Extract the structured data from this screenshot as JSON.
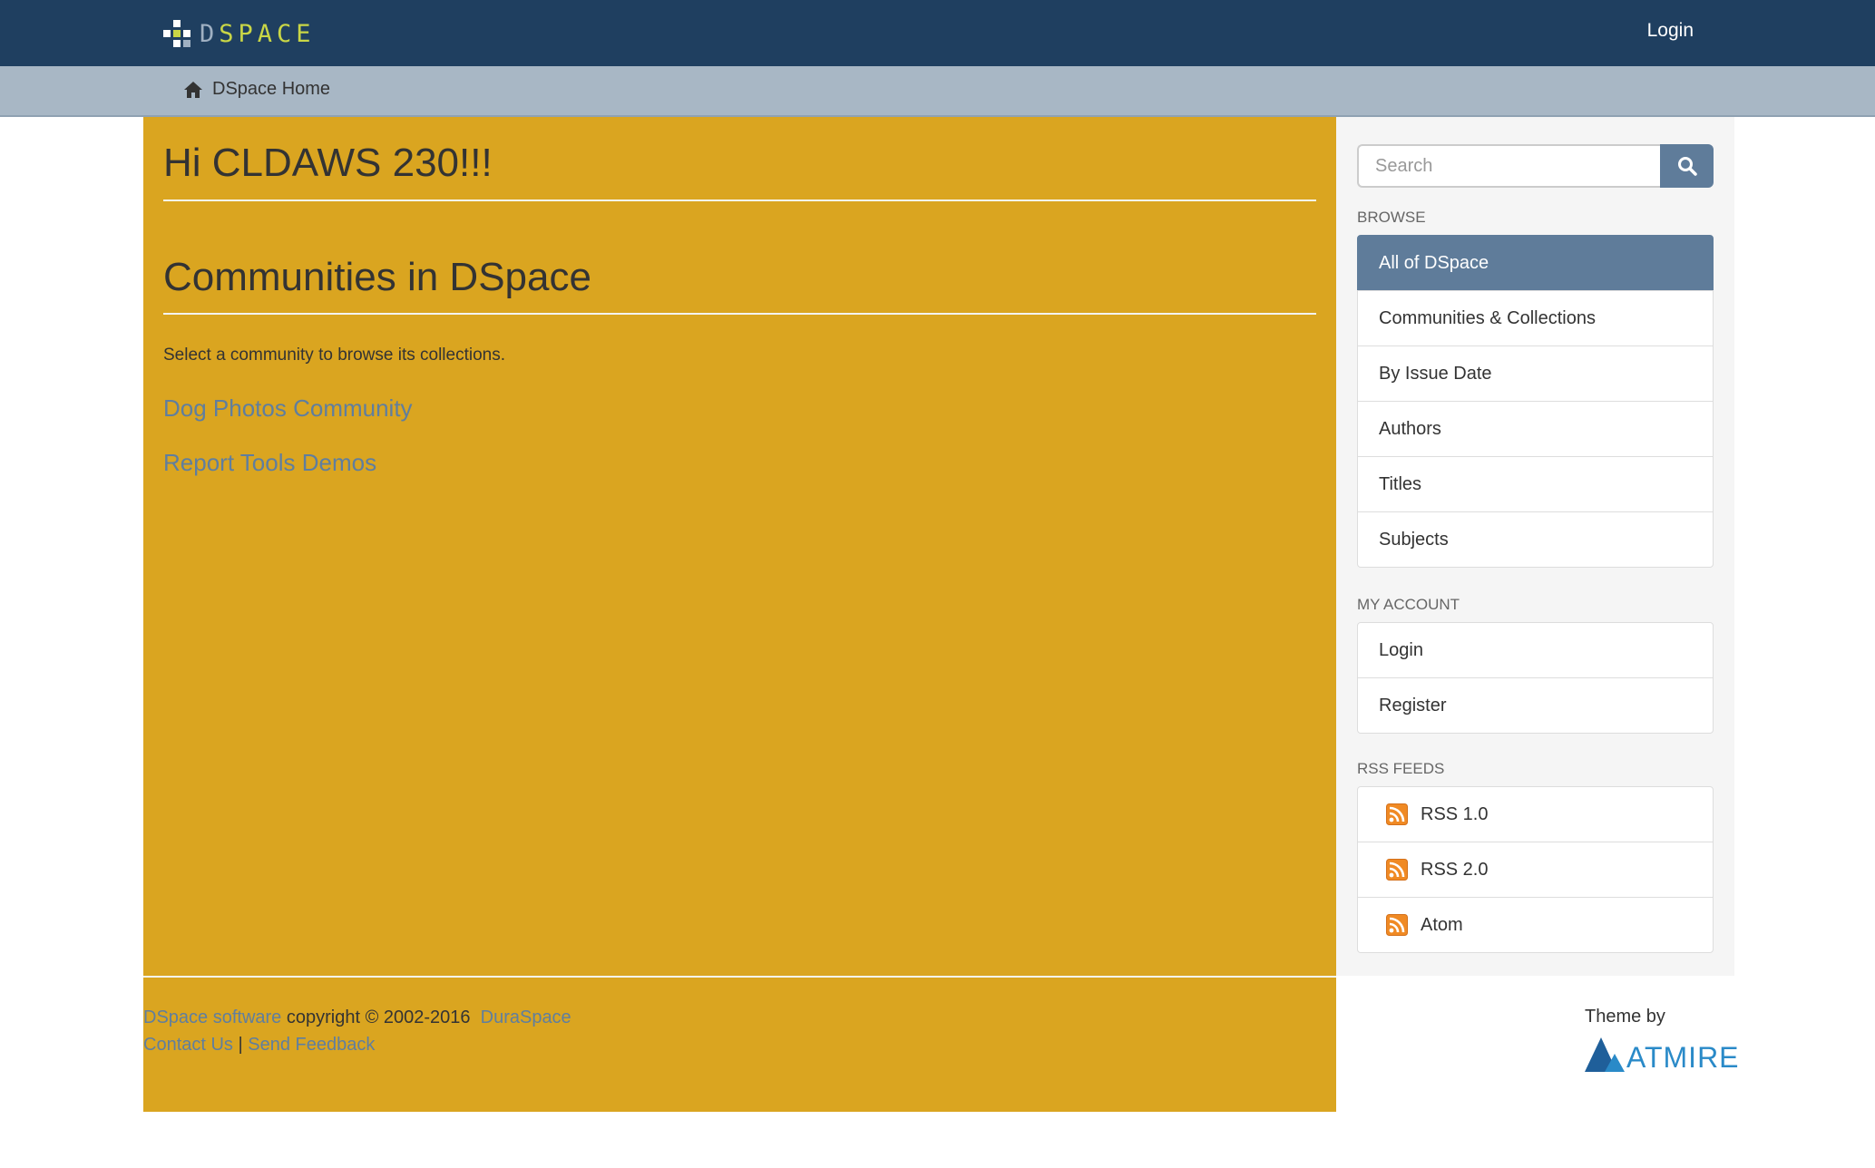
{
  "header": {
    "logo_text_d": "D",
    "logo_text_rest": "SPACE",
    "login_label": "Login",
    "colors": {
      "bar": "#1f3f60",
      "logo_accent": "#c9d646"
    }
  },
  "breadcrumb": {
    "home_icon": "home-icon",
    "label": "DSpace Home"
  },
  "main": {
    "greeting": "Hi CLDAWS 230!!!",
    "section_title": "Communities in DSpace",
    "intro": "Select a community to browse its collections.",
    "communities": [
      {
        "label": "Dog Photos Community"
      },
      {
        "label": "Report Tools Demos"
      }
    ],
    "background_color": "#daa520"
  },
  "sidebar": {
    "search": {
      "placeholder": "Search",
      "button_icon": "search-icon"
    },
    "browse": {
      "heading": "BROWSE",
      "items": [
        {
          "label": "All of DSpace",
          "active": true
        },
        {
          "label": "Communities & Collections"
        },
        {
          "label": "By Issue Date"
        },
        {
          "label": "Authors"
        },
        {
          "label": "Titles"
        },
        {
          "label": "Subjects"
        }
      ]
    },
    "account": {
      "heading": "MY ACCOUNT",
      "items": [
        {
          "label": "Login"
        },
        {
          "label": "Register"
        }
      ]
    },
    "rss": {
      "heading": "RSS FEEDS",
      "items": [
        {
          "label": "RSS 1.0",
          "icon": "rss-icon"
        },
        {
          "label": "RSS 2.0",
          "icon": "rss-icon"
        },
        {
          "label": "Atom",
          "icon": "rss-icon"
        }
      ]
    },
    "active_color": "#5f7c9a"
  },
  "footer": {
    "software_link": "DSpace software",
    "copyright": " copyright © 2002-2016  ",
    "duraspace_link": "DuraSpace",
    "contact_link": "Contact Us",
    "separator": " | ",
    "feedback_link": "Send Feedback",
    "theme_by": "Theme by",
    "theme_brand": "ATMIRE"
  }
}
